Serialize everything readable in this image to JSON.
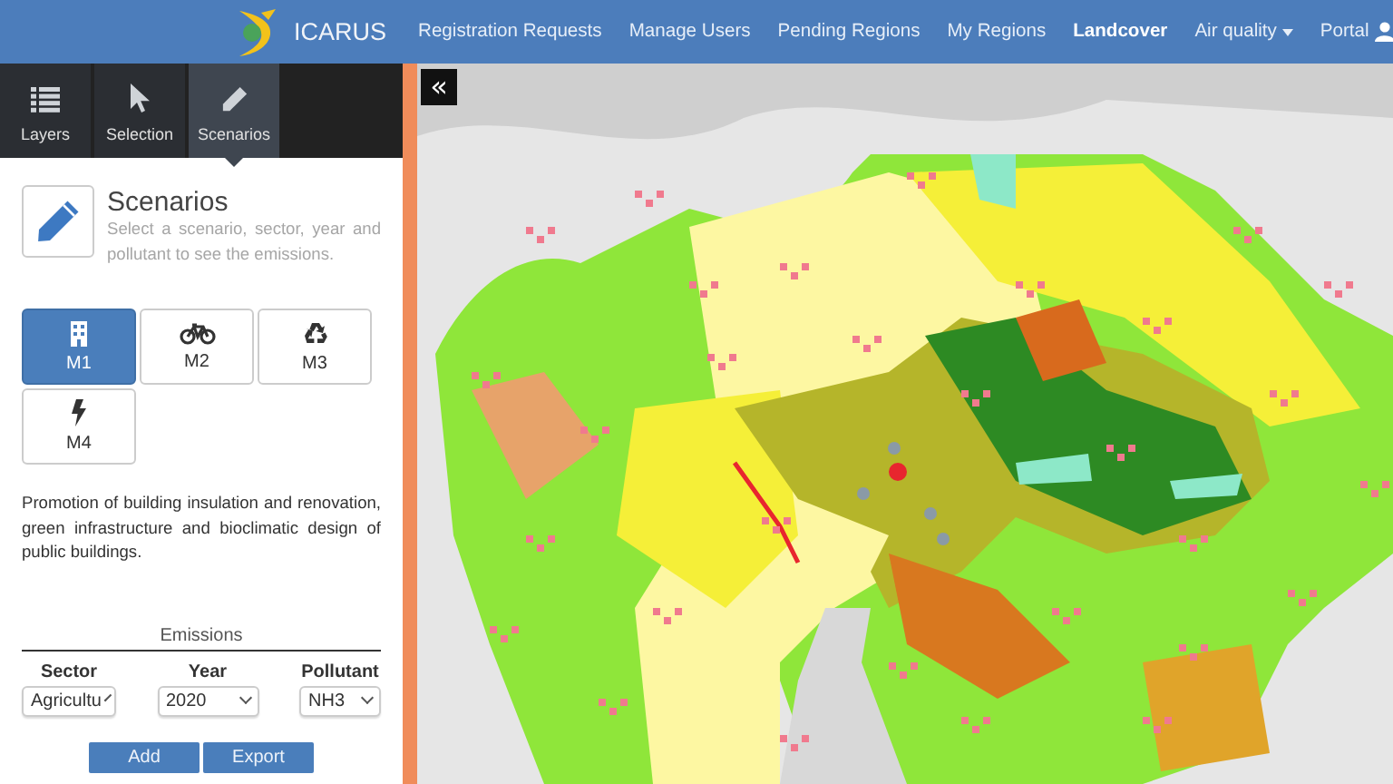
{
  "navbar": {
    "brand": "ICARUS",
    "items": [
      {
        "label": "Registration Requests",
        "selected": false,
        "kind": "link"
      },
      {
        "label": "Manage Users",
        "selected": false,
        "kind": "link"
      },
      {
        "label": "Pending Regions",
        "selected": false,
        "kind": "link"
      },
      {
        "label": "My Regions",
        "selected": false,
        "kind": "link"
      },
      {
        "label": "Landcover",
        "selected": true,
        "kind": "link"
      },
      {
        "label": "Air quality",
        "selected": false,
        "kind": "dropdown"
      },
      {
        "label": "Portal",
        "selected": false,
        "kind": "user-dropdown"
      }
    ]
  },
  "sidebar": {
    "tabs": [
      {
        "label": "Layers",
        "selected": false
      },
      {
        "label": "Selection",
        "selected": false
      },
      {
        "label": "Scenarios",
        "selected": true
      }
    ],
    "panel": {
      "title": "Scenarios",
      "subtitle": "Select a scenario, sector, year and pollutant to see the emissions.",
      "scenarios": [
        {
          "label": "M1",
          "selected": true
        },
        {
          "label": "M2",
          "selected": false
        },
        {
          "label": "M3",
          "selected": false
        },
        {
          "label": "M4",
          "selected": false
        }
      ],
      "description": "Promotion of building insulation and renovation, green infrastructure and bioclimatic design of public buildings.",
      "emissions": {
        "title": "Emissions",
        "fields": [
          {
            "label": "Sector",
            "value": "Agricultu"
          },
          {
            "label": "Year",
            "value": "2020"
          },
          {
            "label": "Pollutant",
            "value": "NH3"
          }
        ],
        "buttons": [
          "Add",
          "Export"
        ]
      }
    }
  },
  "map": {
    "collapse_button": "«"
  }
}
